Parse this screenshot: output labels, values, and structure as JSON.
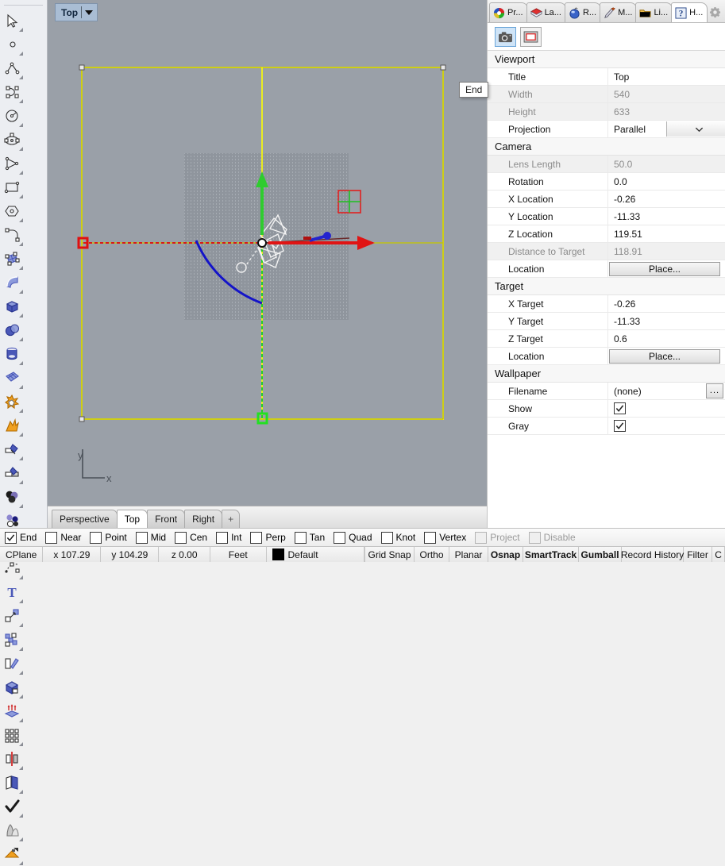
{
  "viewport": {
    "title": "Top",
    "tooltip": "End",
    "axis_x": "x",
    "axis_y": "y",
    "tabs": [
      {
        "label": "Perspective",
        "active": false
      },
      {
        "label": "Top",
        "active": true
      },
      {
        "label": "Front",
        "active": false
      },
      {
        "label": "Right",
        "active": false
      },
      {
        "label": "+",
        "active": false
      }
    ]
  },
  "toolbar": {
    "items": [
      {
        "name": "select-tool",
        "icon": "arrow-cursor-icon"
      },
      {
        "name": "point-tool",
        "icon": "point-icon"
      },
      {
        "name": "polyline-tool",
        "icon": "polyline-icon"
      },
      {
        "name": "curve-control-points-tool",
        "icon": "curve-cv-icon"
      },
      {
        "name": "circle-tool",
        "icon": "circle-icon"
      },
      {
        "name": "ellipse-tool",
        "icon": "ellipse-icon"
      },
      {
        "name": "arc-tool",
        "icon": "arc-triangle-icon"
      },
      {
        "name": "rectangle-tool",
        "icon": "rectangle-icon"
      },
      {
        "name": "polygon-tool",
        "icon": "polygon-icon"
      },
      {
        "name": "fillet-tool",
        "icon": "fillet-curve-icon"
      },
      {
        "name": "surface-from-points-tool",
        "icon": "surface-cv-icon"
      },
      {
        "name": "surface-sweep-tool",
        "icon": "sweep-surface-icon"
      },
      {
        "name": "box-tool",
        "icon": "box-solid-icon"
      },
      {
        "name": "sphere-tool",
        "icon": "sphere-boolean-icon"
      },
      {
        "name": "cylinder-tool",
        "icon": "cylinder-icon"
      },
      {
        "name": "mesh-tool",
        "icon": "mesh-grid-icon"
      },
      {
        "name": "boolean-union-tool",
        "icon": "boolean-union-icon"
      },
      {
        "name": "explode-tool",
        "icon": "explode-burst-icon"
      },
      {
        "name": "trim-tool",
        "icon": "trim-icon"
      },
      {
        "name": "split-tool",
        "icon": "split-icon"
      },
      {
        "name": "render-color-tool",
        "icon": "color-spheres-icon"
      },
      {
        "name": "layer-color-tool",
        "icon": "color-circles-icon"
      },
      {
        "name": "curve-edit-tool",
        "icon": "curve-edit-icon"
      },
      {
        "name": "point-editing-tool",
        "icon": "point-edit-icon"
      },
      {
        "name": "text-tool",
        "icon": "text-t-icon"
      },
      {
        "name": "dimension-tool",
        "icon": "dimension-arrow-icon"
      },
      {
        "name": "group-objects-tool",
        "icon": "group-blocks-icon"
      },
      {
        "name": "block-tool",
        "icon": "block-insert-icon"
      },
      {
        "name": "extrude-solid-tool",
        "icon": "extrude-box-icon"
      },
      {
        "name": "extrude-surface-tool",
        "icon": "extrude-up-icon"
      },
      {
        "name": "array-tool",
        "icon": "array-grid-icon"
      },
      {
        "name": "mirror-tool",
        "icon": "mirror-icon"
      },
      {
        "name": "offset-tool",
        "icon": "offset-pages-icon"
      },
      {
        "name": "check-tool",
        "icon": "checkmark-icon"
      },
      {
        "name": "shade-tool",
        "icon": "shade-cones-icon"
      },
      {
        "name": "render-tool",
        "icon": "render-camera-icon"
      }
    ]
  },
  "panel": {
    "tabs": [
      {
        "label": "Pr...",
        "name": "tab-properties",
        "icon": "color-wheel-icon",
        "active": false
      },
      {
        "label": "La...",
        "name": "tab-layers",
        "icon": "layers-icon",
        "active": false
      },
      {
        "label": "R...",
        "name": "tab-render",
        "icon": "render-sphere-icon",
        "active": false
      },
      {
        "label": "M...",
        "name": "tab-materials",
        "icon": "brush-icon",
        "active": false
      },
      {
        "label": "Li...",
        "name": "tab-libraries",
        "icon": "folder-icon",
        "active": false
      },
      {
        "label": "H...",
        "name": "tab-help",
        "icon": "help-question-icon",
        "active": true
      }
    ],
    "subbuttons": [
      {
        "name": "camera-properties-button",
        "icon": "camera-icon",
        "selected": true
      },
      {
        "name": "viewport-properties-button",
        "icon": "frame-icon",
        "selected": false
      }
    ],
    "groups": [
      {
        "name": "viewport",
        "title": "Viewport",
        "rows": [
          {
            "label": "Title",
            "value": "Top",
            "type": "text",
            "readonly": false
          },
          {
            "label": "Width",
            "value": "540",
            "type": "text",
            "readonly": true
          },
          {
            "label": "Height",
            "value": "633",
            "type": "text",
            "readonly": true
          },
          {
            "label": "Projection",
            "value": "Parallel",
            "type": "combo",
            "readonly": false
          }
        ]
      },
      {
        "name": "camera",
        "title": "Camera",
        "rows": [
          {
            "label": "Lens Length",
            "value": "50.0",
            "type": "text",
            "readonly": true
          },
          {
            "label": "Rotation",
            "value": "0.0",
            "type": "text",
            "readonly": false
          },
          {
            "label": "X Location",
            "value": "-0.26",
            "type": "text",
            "readonly": false
          },
          {
            "label": "Y Location",
            "value": "-11.33",
            "type": "text",
            "readonly": false
          },
          {
            "label": "Z Location",
            "value": "119.51",
            "type": "text",
            "readonly": false
          },
          {
            "label": "Distance to Target",
            "value": "118.91",
            "type": "text",
            "readonly": true
          },
          {
            "label": "Location",
            "value": "Place...",
            "type": "button",
            "readonly": false
          }
        ]
      },
      {
        "name": "target",
        "title": "Target",
        "rows": [
          {
            "label": "X Target",
            "value": "-0.26",
            "type": "text",
            "readonly": false
          },
          {
            "label": "Y Target",
            "value": "-11.33",
            "type": "text",
            "readonly": false
          },
          {
            "label": "Z Target",
            "value": "0.6",
            "type": "text",
            "readonly": false
          },
          {
            "label": "Location",
            "value": "Place...",
            "type": "button",
            "readonly": false
          }
        ]
      },
      {
        "name": "wallpaper",
        "title": "Wallpaper",
        "rows": [
          {
            "label": "Filename",
            "value": "(none)",
            "type": "file",
            "browse": "...",
            "readonly": false
          },
          {
            "label": "Show",
            "value": "",
            "type": "checkbox",
            "checked": true,
            "readonly": false
          },
          {
            "label": "Gray",
            "value": "",
            "type": "checkbox",
            "checked": true,
            "readonly": false
          }
        ]
      }
    ]
  },
  "osnap": {
    "items": [
      {
        "label": "End",
        "checked": true,
        "disabled": false
      },
      {
        "label": "Near",
        "checked": false,
        "disabled": false
      },
      {
        "label": "Point",
        "checked": false,
        "disabled": false
      },
      {
        "label": "Mid",
        "checked": false,
        "disabled": false
      },
      {
        "label": "Cen",
        "checked": false,
        "disabled": false
      },
      {
        "label": "Int",
        "checked": false,
        "disabled": false
      },
      {
        "label": "Perp",
        "checked": false,
        "disabled": false
      },
      {
        "label": "Tan",
        "checked": false,
        "disabled": false
      },
      {
        "label": "Quad",
        "checked": false,
        "disabled": false
      },
      {
        "label": "Knot",
        "checked": false,
        "disabled": false
      },
      {
        "label": "Vertex",
        "checked": false,
        "disabled": false
      },
      {
        "label": "Project",
        "checked": false,
        "disabled": true
      },
      {
        "label": "Disable",
        "checked": false,
        "disabled": true
      }
    ]
  },
  "status": {
    "cplane": "CPlane",
    "x": "x 107.29",
    "y": "y 104.29",
    "z": "z 0.00",
    "units": "Feet",
    "layer": "Default",
    "layer_color": "#000000",
    "toggles": [
      {
        "label": "Grid Snap",
        "active": false
      },
      {
        "label": "Ortho",
        "active": false
      },
      {
        "label": "Planar",
        "active": false
      },
      {
        "label": "Osnap",
        "active": true
      },
      {
        "label": "SmartTrack",
        "active": true
      },
      {
        "label": "Gumball",
        "active": true
      },
      {
        "label": "Record History",
        "active": false
      },
      {
        "label": "Filter",
        "active": false
      },
      {
        "label": "C",
        "active": false
      }
    ]
  },
  "colors": {
    "viewport_bg": "#9aa0a8",
    "grid_panel": "#8f959d",
    "axis_x": "#d81919",
    "axis_y": "#17b317",
    "selection": "#ffff00",
    "curve": "#1414c8",
    "grid_red": "#e02020",
    "grid_green": "#20c020"
  }
}
